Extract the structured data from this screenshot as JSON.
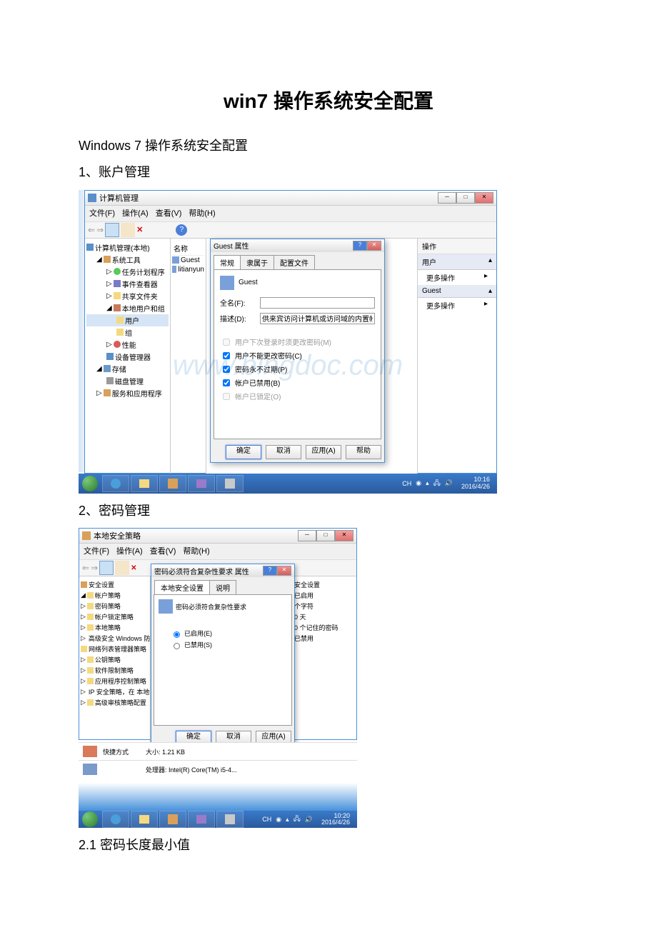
{
  "doc": {
    "title": "win7 操作系统安全配置",
    "subtitle": "Windows 7 操作系统安全配置",
    "section1": "1、账户管理",
    "section2": "2、密码管理",
    "section21": "2.1 密码长度最小值"
  },
  "watermark": "www.bingdoc.com",
  "s1": {
    "window_title": "计算机管理",
    "menu": {
      "file": "文件(F)",
      "action": "操作(A)",
      "view": "查看(V)",
      "help": "帮助(H)"
    },
    "tree": {
      "root": "计算机管理(本地)",
      "sys_tools": "系统工具",
      "task": "任务计划程序",
      "event": "事件查看器",
      "share": "共享文件夹",
      "local_users": "本地用户和组",
      "users": "用户",
      "groups": "组",
      "perf": "性能",
      "devmgr": "设备管理器",
      "storage": "存储",
      "diskmgr": "磁盘管理",
      "services": "服务和应用程序"
    },
    "mid": {
      "col_name": "名称",
      "guest": "Guest",
      "litianyun": "litianyun"
    },
    "right": {
      "header": "操作",
      "sec_user": "用户",
      "more_ops": "更多操作",
      "sec_guest": "Guest"
    },
    "dlg": {
      "title": "Guest 属性",
      "tab_general": "常规",
      "tab_member": "隶属于",
      "tab_profile": "配置文件",
      "username": "Guest",
      "fullname_label": "全名(F):",
      "fullname_value": "",
      "desc_label": "描述(D):",
      "desc_value": "供来宾访问计算机或访问域的内置帐户",
      "chk1": "用户下次登录时须更改密码(M)",
      "chk2": "用户不能更改密码(C)",
      "chk3": "密码永不过期(P)",
      "chk4": "帐户已禁用(B)",
      "chk5": "帐户已锁定(O)",
      "btn_ok": "确定",
      "btn_cancel": "取消",
      "btn_apply": "应用(A)",
      "btn_help": "帮助"
    },
    "tray": {
      "ime": "CH",
      "time": "10:16",
      "date": "2016/4/26"
    }
  },
  "s2": {
    "window_title": "本地安全策略",
    "menu": {
      "file": "文件(F)",
      "action": "操作(A)",
      "view": "查看(V)",
      "help": "帮助(H)"
    },
    "tree": {
      "root": "安全设置",
      "account": "帐户策略",
      "pwd": "密码策略",
      "lockout": "帐户锁定策略",
      "local": "本地策略",
      "firewall": "高级安全 Windows 防火",
      "nlm": "网络列表管理器策略",
      "pubkey": "公钥策略",
      "softres": "软件限制策略",
      "appctl": "应用程序控制策略",
      "ipsec": "IP 安全策略，在 本地计",
      "audit": "高级审核策略配置"
    },
    "right": {
      "h": "安全设置",
      "v1": "已启用",
      "v2": "个字符",
      "v3": "0 天",
      "v4": "0 个记住的密码",
      "v5": "已禁用"
    },
    "dlg": {
      "title": "密码必须符合复杂性要求 属性",
      "tab_local": "本地安全设置",
      "tab_explain": "说明",
      "policy_name": "密码必须符合复杂性要求",
      "radio_enabled": "已启用(E)",
      "radio_disabled": "已禁用(S)",
      "btn_ok": "确定",
      "btn_cancel": "取消",
      "btn_apply": "应用(A)"
    },
    "info": {
      "shortcut_label": "快捷方式",
      "shortcut_size": "大小: 1.21 KB",
      "cpu_label": "处理器: Intel(R) Core(TM) i5-4..."
    },
    "tray": {
      "ime": "CH",
      "time": "10:20",
      "date": "2016/4/26"
    }
  }
}
